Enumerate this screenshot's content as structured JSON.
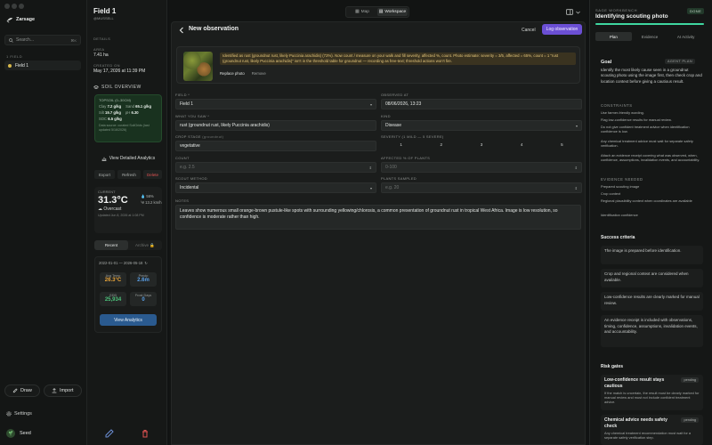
{
  "app": {
    "name": "Zarsage"
  },
  "nav": {
    "search_placeholder": "Search...",
    "search_shortcut": "⌘K",
    "fields_header": "1 FIELD",
    "field_item": "Field 1",
    "draw": "Draw",
    "import": "Import",
    "settings": "Settings",
    "user": "Seed"
  },
  "field": {
    "title": "Field 1",
    "owner": "@MUSSELL",
    "details_label": "DETAILS",
    "area_label": "AREA",
    "area": "7.41 ha",
    "created_label": "CREATED ON",
    "created": "May 17, 2026 at 11:39 PM",
    "soil_section": "SOIL OVERVIEW",
    "soil": {
      "depth": "TOPSOIL (0–30CM)",
      "clay_l": "Clay",
      "clay": "7.2 g/kg",
      "sand_l": "Sand",
      "sand": "65.1 g/kg",
      "silt_l": "Silt",
      "silt": "19.7 g/kg",
      "ph_l": "pH",
      "ph": "6.30",
      "soc_l": "SOC",
      "soc": "6.5 g/kg",
      "note": "Data source: curated SoilGrids (last updated 5/16/2026)"
    },
    "detailed_analytics": "View Detailed Analytics",
    "export": "Export",
    "refresh": "Refresh",
    "delete": "Delete",
    "weather": {
      "current_label": "CURRENT",
      "temp": "31.3°C",
      "condition": "Overcast",
      "updated": "Updated Jun 8, 2026 at 1:08 PM",
      "humidity": "56%",
      "wind": "13.2 km/h"
    },
    "tabs": {
      "recent": "Recent",
      "archive": "Archive"
    },
    "history": {
      "range": "2022-01-01 — 2026-05-18",
      "avg_temp_l": "Avg Temp",
      "avg_temp": "26.3°C",
      "precip_l": "Precip",
      "precip": "2.6m",
      "gdd_l": "GDD",
      "gdd": "25,934",
      "frost_l": "Frost Days",
      "frost": "0",
      "view_analytics": "View Analytics"
    }
  },
  "toolbar": {
    "map": "Map",
    "workspace": "Workspace"
  },
  "obs": {
    "title": "New observation",
    "cancel": "Cancel",
    "log": "Log observation",
    "photo_msg": "Identified as rust (groundnut rust, likely Puccinia arachidis) (72%). Now count / measure on your walk and fill severity, affected %, count. Photo estimate: severity = 3/5, affected = 65%, count = 1 \"rust (groundnut rust, likely Puccinia arachidis)\" isn't in the threshold table for groundnut — recording as free-text; threshold actions won't fire.",
    "replace_photo": "Replace photo",
    "remove": "Remove",
    "field_label": "FIELD *",
    "field_value": "Field 1",
    "observed_label": "OBSERVED AT",
    "observed_value": "08/06/2026, 13:23",
    "what_label": "WHAT YOU SAW *",
    "what_value": "rust (groundnut rust, likely Puccinia arachidis)",
    "kind_label": "KIND",
    "kind_value": "Disease",
    "crop_label": "CROP STAGE",
    "crop_hint": "(groundnut)",
    "crop_value": "vegetative",
    "severity_label": "SEVERITY (1 MILD — 5 SEVERE)",
    "severity": [
      "1",
      "2",
      "3",
      "4",
      "5"
    ],
    "count_label": "COUNT",
    "count_placeholder": "e.g. 2.5",
    "affected_label": "AFFECTED % OF PLANTS",
    "affected_placeholder": "0-100",
    "method_label": "SCOUT METHOD",
    "method_value": "Incidental",
    "sampled_label": "PLANTS SAMPLED",
    "sampled_placeholder": "e.g. 20",
    "notes_label": "NOTES",
    "notes": "Leaves show numerous small orange-brown pustule-like spots with surrounding yellowing/chlorosis, a common presentation of groundnut rust in tropical West Africa. Image is low resolution, so confidence is moderate rather than high."
  },
  "workbench": {
    "label": "SAGE WORKBENCH",
    "status": "DONE",
    "title": "Identifying scouting photo",
    "progress": 1.0,
    "tabs": [
      "Plan",
      "Evidence",
      "AI Activity"
    ],
    "goal_label": "Goal",
    "agent_plan": "AGENT PLAN",
    "goal": "Identify the most likely cause seen in a groundnut scouting photo using the image first, then check crop and location context before giving a cautious result.",
    "constraints_label": "CONSTRAINTS",
    "constraints": [
      "Use farmer-friendly wording.",
      "Flag low-confidence results for manual review.",
      "Do not give confident treatment advice when identification confidence is low.",
      "Any chemical treatment advice must wait for separate safety verification.",
      "Attach an evidence receipt covering what was observed, when, confidence, assumptions, invalidation events, and accountability."
    ],
    "evidence_label": "EVIDENCE NEEDED",
    "evidence": [
      "Prepared scouting image",
      "Crop context",
      "Regional plausibility context when coordinates are available",
      "Identification confidence"
    ],
    "success_label": "Success criteria",
    "success": [
      "The image is prepared before identification.",
      "Crop and regional context are considered when available.",
      "Low-confidence results are clearly marked for manual review.",
      "An evidence receipt is included with observations, timing, confidence, assumptions, invalidation events, and accountability."
    ],
    "gates_label": "Risk gates",
    "gates": [
      {
        "title": "Low-confidence result stays cautious",
        "status": "pending",
        "desc": "If the match is uncertain, the result must be clearly marked for manual review and must not include confident treatment advice."
      },
      {
        "title": "Chemical advice needs safety check",
        "status": "pending",
        "desc": "Any chemical treatment recommendation must wait for a separate safety verification step."
      }
    ]
  },
  "colors": {
    "accent": "#6b4fd4",
    "done_green": "#3fd7a0",
    "delete_red": "#e05252",
    "analytics_blue": "#2a5a8f"
  }
}
